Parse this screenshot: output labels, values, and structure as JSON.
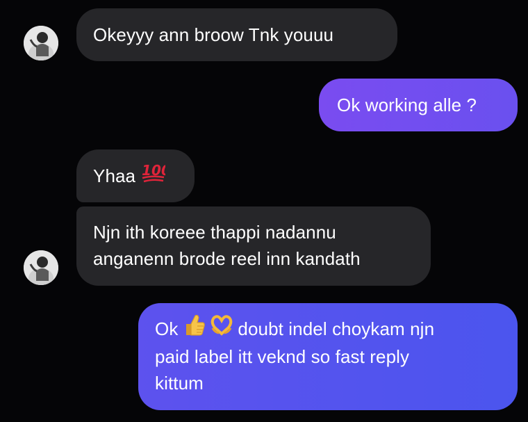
{
  "chat": {
    "messages": [
      {
        "sender": "other",
        "text": "Okeyyy ann broow Tnk youuu",
        "avatar_shown": true
      },
      {
        "sender": "me",
        "text": "Ok working alle ?"
      },
      {
        "sender": "other",
        "text": "Yhaa",
        "emoji": "hundred-points-icon"
      },
      {
        "sender": "other",
        "lines": [
          "Njn ith koreee thappi nadannu",
          "anganenn brode reel inn kandath"
        ],
        "avatar_shown": true
      },
      {
        "sender": "me",
        "line1_prefix": "Ok",
        "line1_emojis": [
          "thumbs-up-icon",
          "heart-hands-icon"
        ],
        "line1_suffix": "doubt indel choykam njn",
        "lines_rest": [
          "paid label itt veknd so fast reply",
          "kittum"
        ]
      }
    ]
  },
  "colors": {
    "background": "#050507",
    "incoming_bubble": "#262629",
    "outgoing_gradient_start": "#7a4cf0",
    "outgoing_gradient_end": "#4b55ee",
    "text": "#ffffff"
  }
}
